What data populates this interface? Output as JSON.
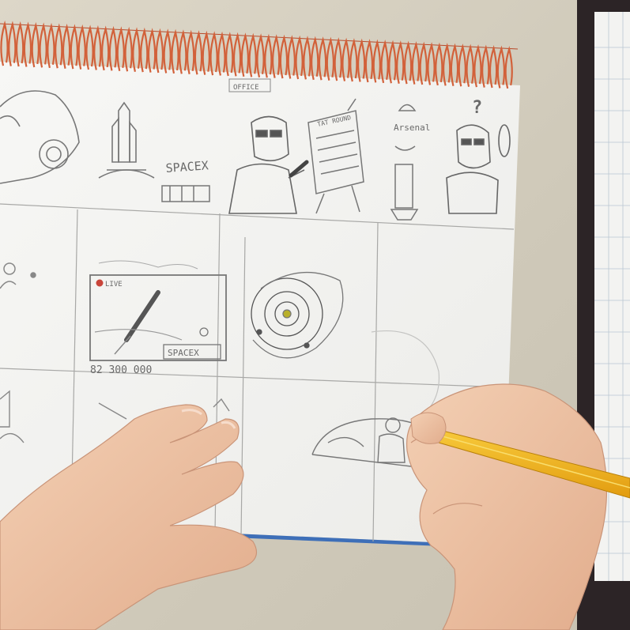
{
  "scene": {
    "description_tag": "sketchbook-storyboard-photo"
  },
  "panels": {
    "office_label": "OFFICE",
    "spacex_label_1": "SPACEX",
    "easel_text": "TAT ROUND",
    "antenna_label": "Arsenal",
    "live_badge": "LIVE",
    "spacex_label_2": "SPACEX",
    "viewer_count": "82 300 000",
    "question_mark": "?"
  },
  "colors": {
    "paper": "#f4f4f2",
    "spiral": "#d2613a",
    "pencil": "#f2b51c",
    "skin": "#eec3a3",
    "graphite": "#7b7b7b",
    "live_dot": "#c9453a"
  }
}
